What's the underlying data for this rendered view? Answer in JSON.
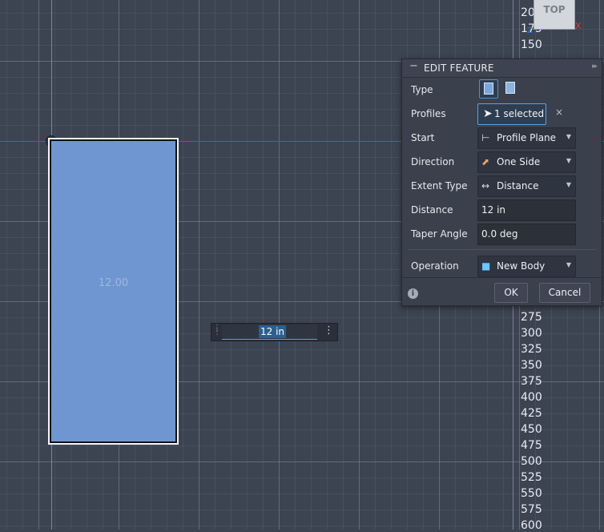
{
  "viewport": {
    "sketch_dimension": "12.00",
    "view_cube_label": "TOP",
    "cube_axis_z": "Z",
    "cube_axis_x": "X",
    "ruler_ticks": [
      "200",
      "175",
      "150",
      "275",
      "300",
      "325",
      "350",
      "375",
      "400",
      "425",
      "450",
      "475",
      "500",
      "525",
      "550",
      "575",
      "600"
    ]
  },
  "distance_input": {
    "value": "12 in",
    "menu_icon": "more-vertical-icon"
  },
  "panel": {
    "title": "EDIT FEATURE",
    "type_label": "Type",
    "profiles_label": "Profiles",
    "profiles_value": "1 selected",
    "clear_symbol": "×",
    "start_label": "Start",
    "start_value": "Profile Plane",
    "direction_label": "Direction",
    "direction_value": "One Side",
    "extent_type_label": "Extent Type",
    "extent_type_value": "Distance",
    "distance_label": "Distance",
    "distance_value": "12 in",
    "taper_angle_label": "Taper Angle",
    "taper_angle_value": "0.0 deg",
    "operation_label": "Operation",
    "operation_value": "New Body",
    "ok_label": "OK",
    "cancel_label": "Cancel",
    "info_symbol": "i"
  },
  "colors": {
    "sketch_fill": "#6f96d0",
    "accent_blue": "#4fa3e6",
    "axis_x": "#c03a3a",
    "axis_y": "#3dbb4d"
  }
}
